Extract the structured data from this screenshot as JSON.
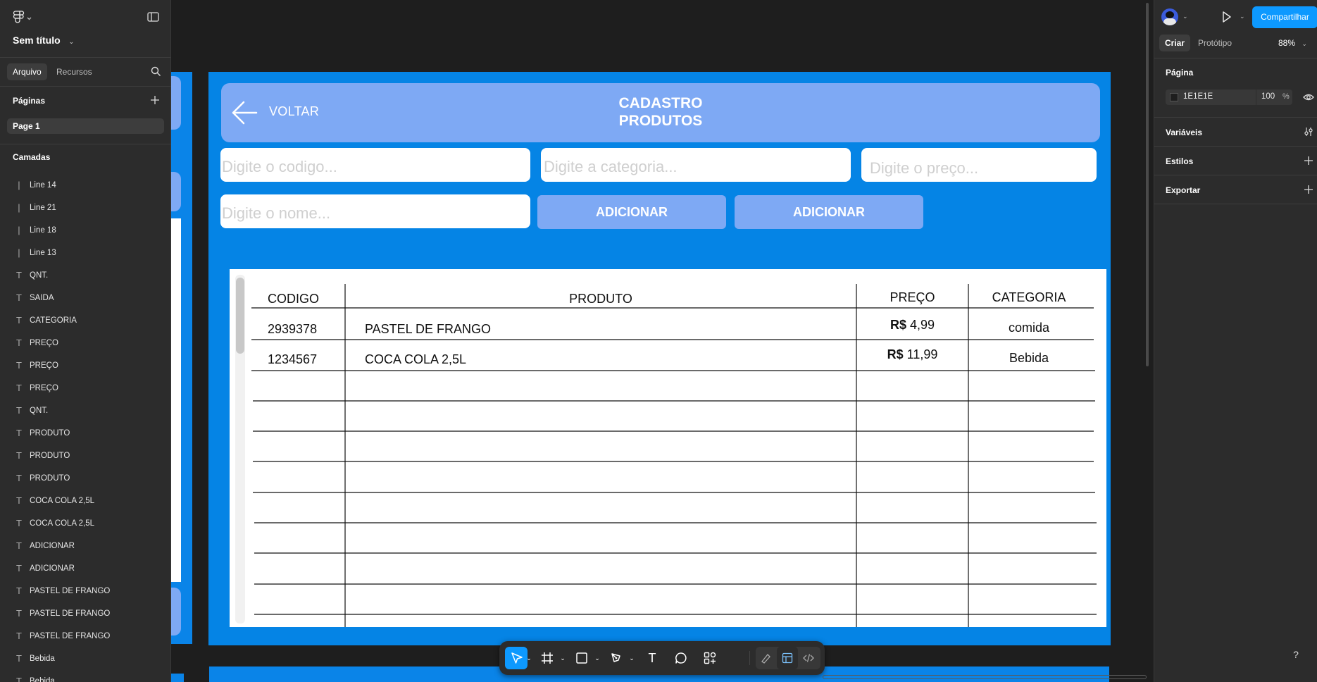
{
  "file": {
    "title": "Sem título"
  },
  "left_panel": {
    "tabs": [
      "Arquivo",
      "Recursos"
    ],
    "pages_heading": "Páginas",
    "pages": [
      "Page 1"
    ],
    "layers_heading": "Camadas",
    "layers": [
      {
        "type": "line",
        "name": "Line 14"
      },
      {
        "type": "line",
        "name": "Line 21"
      },
      {
        "type": "line",
        "name": "Line 18"
      },
      {
        "type": "line",
        "name": "Line 13"
      },
      {
        "type": "text",
        "name": "QNT."
      },
      {
        "type": "text",
        "name": "SAIDA"
      },
      {
        "type": "text",
        "name": "CATEGORIA"
      },
      {
        "type": "text",
        "name": "PREÇO"
      },
      {
        "type": "text",
        "name": "PREÇO"
      },
      {
        "type": "text",
        "name": "PREÇO"
      },
      {
        "type": "text",
        "name": "QNT."
      },
      {
        "type": "text",
        "name": "PRODUTO"
      },
      {
        "type": "text",
        "name": "PRODUTO"
      },
      {
        "type": "text",
        "name": "PRODUTO"
      },
      {
        "type": "text",
        "name": "COCA COLA 2,5L"
      },
      {
        "type": "text",
        "name": "COCA COLA 2,5L"
      },
      {
        "type": "text",
        "name": "ADICIONAR"
      },
      {
        "type": "text",
        "name": "ADICIONAR"
      },
      {
        "type": "text",
        "name": "PASTEL DE FRANGO"
      },
      {
        "type": "text",
        "name": "PASTEL DE FRANGO"
      },
      {
        "type": "text",
        "name": "PASTEL DE FRANGO"
      },
      {
        "type": "text",
        "name": "Bebida"
      },
      {
        "type": "text",
        "name": "Bebida"
      }
    ]
  },
  "right_panel": {
    "share_label": "Compartilhar",
    "tabs": [
      "Criar",
      "Protótipo"
    ],
    "zoom": "88%",
    "page_heading": "Página",
    "page_color": "1E1E1E",
    "page_opacity": "100",
    "percent": "%",
    "sections": [
      "Variáveis",
      "Estilos",
      "Exportar"
    ]
  },
  "design": {
    "back_label": "VOLTAR",
    "title_line1": "CADASTRO",
    "title_line2": "PRODUTOS",
    "placeholders": {
      "codigo": "Digite o codigo...",
      "categoria": "Digite a categoria...",
      "preco": "Digite o preço...",
      "nome": "Digite o nome..."
    },
    "buttons": [
      "ADICIONAR",
      "ADICIONAR"
    ],
    "table": {
      "headers": [
        "CODIGO",
        "PRODUTO",
        "PREÇO",
        "CATEGORIA"
      ],
      "currency": "R$",
      "rows": [
        {
          "codigo": "2939378",
          "produto": "PASTEL DE FRANGO",
          "preco": "4,99",
          "categoria": "comida"
        },
        {
          "codigo": "1234567",
          "produto": "COCA COLA 2,5L",
          "preco": "11,99",
          "categoria": "Bebida"
        }
      ]
    }
  },
  "toolbar": {
    "text_tool_glyph": "T"
  },
  "help_glyph": "?",
  "colors": {
    "canvas": "#1e1e1e",
    "frame_blue": "#0584e5",
    "light_blue": "#7ea9f4",
    "accent": "#0d99ff"
  }
}
